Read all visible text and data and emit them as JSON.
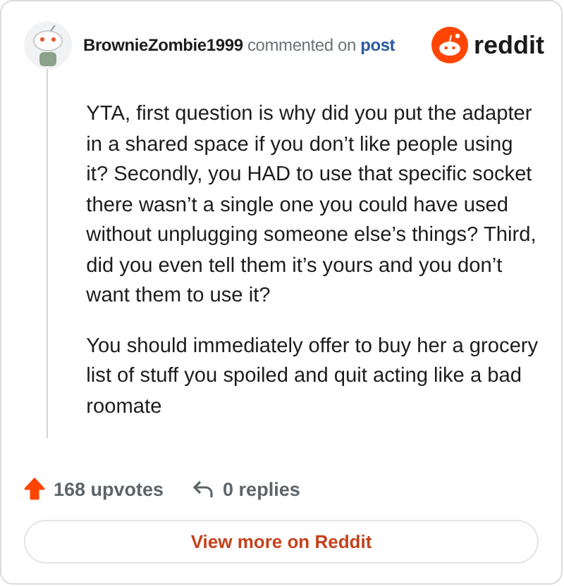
{
  "comment": {
    "author": "BrownieZombie1999",
    "action": "commented on",
    "link": "post"
  },
  "brand": {
    "name": "reddit"
  },
  "paragraphs": [
    "YTA, first question is why did you put the adapter in a shared space if you don’t like people using it? Secondly, you HAD to use that specific socket there wasn’t a single one you could have used without unplugging someone else’s things? Third, did you even tell them it’s yours and you don’t want them to use it?",
    "You should immediately offer to buy her a grocery list of stuff you spoiled and quit acting like a bad roomate"
  ],
  "footer": {
    "upvotes": "168 upvotes",
    "upvoted": true,
    "replies": "0 replies"
  },
  "button": {
    "label": "View more on Reddit"
  }
}
